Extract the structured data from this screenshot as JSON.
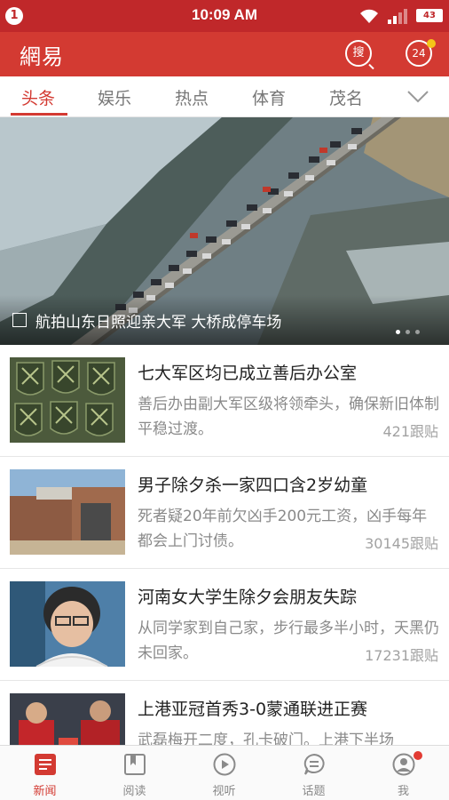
{
  "status_bar": {
    "notification_badge": "1",
    "time": "10:09 AM",
    "battery": "43"
  },
  "app_bar": {
    "logo": "網易",
    "search_label": "搜",
    "message_count": "24"
  },
  "tabs": [
    {
      "label": "头条",
      "active": true
    },
    {
      "label": "娱乐",
      "active": false
    },
    {
      "label": "热点",
      "active": false
    },
    {
      "label": "体育",
      "active": false
    },
    {
      "label": "茂名",
      "active": false
    }
  ],
  "hero": {
    "caption": "航拍山东日照迎亲大军 大桥成停车场",
    "page_count": 3,
    "current_page": 1
  },
  "articles": [
    {
      "title": "七大军区均已成立善后办公室",
      "summary": "善后办由副大军区级将领牵头，确保新旧体制平稳过渡。",
      "comments": "421跟贴",
      "thumb": "badges"
    },
    {
      "title": "男子除夕杀一家四口含2岁幼童",
      "summary": "死者疑20年前欠凶手200元工资，凶手每年都会上门讨债。",
      "comments": "30145跟贴",
      "thumb": "house"
    },
    {
      "title": "河南女大学生除夕会朋友失踪",
      "summary": "从同学家到自己家，步行最多半小时，天黑仍未回家。",
      "comments": "17231跟贴",
      "thumb": "portrait"
    },
    {
      "title": "上港亚冠首秀3-0蒙通联进正赛",
      "summary": "武磊梅开二度，孔卡破门。上港下半场",
      "comments": "",
      "thumb": "soccer"
    }
  ],
  "bottom_nav": [
    {
      "label": "新闻",
      "icon": "news-icon",
      "active": true
    },
    {
      "label": "阅读",
      "icon": "book-icon",
      "active": false
    },
    {
      "label": "视听",
      "icon": "play-icon",
      "active": false
    },
    {
      "label": "话题",
      "icon": "chat-icon",
      "active": false
    },
    {
      "label": "我",
      "icon": "user-icon",
      "active": false
    }
  ],
  "colors": {
    "brand_red": "#d33a32",
    "status_red": "#c0282a",
    "accent_yellow": "#f5c518"
  }
}
